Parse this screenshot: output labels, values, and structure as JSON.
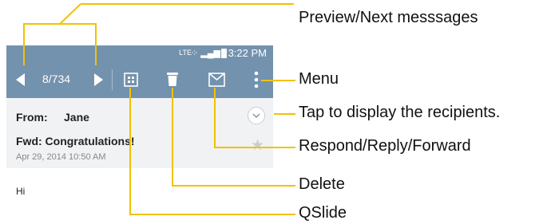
{
  "status": {
    "network": "LTE",
    "time": "3:22 PM"
  },
  "toolbar": {
    "counter": "8/734"
  },
  "message": {
    "from_label": "From:",
    "from_name": "Jane",
    "subject": "Fwd: Congratulations!",
    "date": "Apr 29, 2014 10:50 AM",
    "body": "Hi"
  },
  "callouts": {
    "preview_next": "Preview/Next messsages",
    "menu": "Menu",
    "recipients": "Tap to display the recipients.",
    "respond": "Respond/Reply/Forward",
    "delete": "Delete",
    "qslide": "QSlide"
  },
  "icons": [
    "prev-arrow-icon",
    "next-arrow-icon",
    "qslide-icon",
    "trash-icon",
    "reply-icon",
    "menu-icon",
    "chevron-down-icon",
    "star-icon"
  ],
  "colors": {
    "toolbar": "#7392ae",
    "callout_line": "#f2c200",
    "header_bg": "#f0f2f4"
  }
}
